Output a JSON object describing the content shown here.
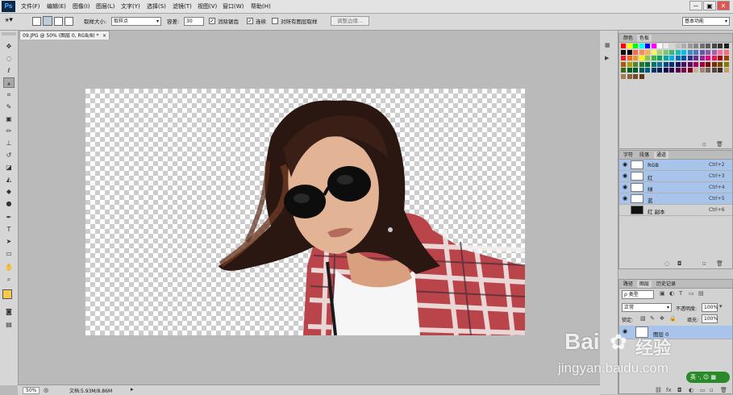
{
  "app": {
    "logo": "Ps"
  },
  "menu": [
    "文件(F)",
    "编辑(E)",
    "图像(I)",
    "图层(L)",
    "文字(Y)",
    "选择(S)",
    "滤镜(T)",
    "视图(V)",
    "窗口(W)",
    "帮助(H)"
  ],
  "window_controls": [
    "－",
    "▣",
    "✕"
  ],
  "options": {
    "sample_size_label": "取样大小:",
    "sample_size_value": "取样点",
    "tolerance_label": "容差:",
    "tolerance_value": "30",
    "antialias_label": "消除锯齿",
    "contiguous_label": "连续",
    "all_layers_label": "对所有图层取样",
    "refine_edge_label": "调整边缘...",
    "workspace": "基本功能"
  },
  "document": {
    "tab_title": "09.JPG @ 50% (图层 0, RGB/8) *",
    "close": "×"
  },
  "status": {
    "zoom": "50%",
    "doc_info": "文档:5.93M/8.86M"
  },
  "swatches_panel": {
    "tabs": [
      "颜色",
      "色板"
    ],
    "active": 1
  },
  "swatch_colors": [
    "#ff0000",
    "#ffff00",
    "#00ff00",
    "#00ffff",
    "#0000ff",
    "#ff00ff",
    "#ffffff",
    "#ebebeb",
    "#d6d6d6",
    "#c2c2c2",
    "#adadad",
    "#999999",
    "#858585",
    "#707070",
    "#5c5c5c",
    "#474747",
    "#333333",
    "#1f1f1f",
    "#0a0a0a",
    "#000000",
    "#f26c4f",
    "#f68e55",
    "#fbaf5c",
    "#fff467",
    "#acd372",
    "#7cc576",
    "#3bb878",
    "#1abbb4",
    "#00bff3",
    "#438ccb",
    "#5574b9",
    "#605ca8",
    "#855fa8",
    "#a763a8",
    "#f06ea9",
    "#f26d7d",
    "#ed1c24",
    "#f26522",
    "#f7941d",
    "#fff200",
    "#8dc73f",
    "#39b54a",
    "#00a651",
    "#00a99d",
    "#00aeef",
    "#0072bc",
    "#0054a6",
    "#2e3192",
    "#662d91",
    "#92278f",
    "#ec008c",
    "#ed145b",
    "#9e0b0f",
    "#a0410d",
    "#a3620a",
    "#aba000",
    "#598527",
    "#197b30",
    "#007236",
    "#00746b",
    "#0076a3",
    "#004a80",
    "#003471",
    "#1b1464",
    "#440e62",
    "#630460",
    "#9e005d",
    "#9e0039",
    "#790000",
    "#7b2e00",
    "#7d4900",
    "#827b00",
    "#406618",
    "#005e20",
    "#005826",
    "#005952",
    "#005b7f",
    "#003663",
    "#002157",
    "#0d004c",
    "#32004b",
    "#4b0049",
    "#7b0046",
    "#7a0026",
    "#c7b299",
    "#998675",
    "#736357",
    "#534741",
    "#37302a",
    "#c69c6d",
    "#a67c52",
    "#8c6239",
    "#754c24",
    "#603913"
  ],
  "channels_panel": {
    "tabs": [
      "字符",
      "段落",
      "通道"
    ],
    "active": 2,
    "rows": [
      {
        "name": "RGB",
        "shortcut": "Ctrl+2",
        "selected": true,
        "visible": true
      },
      {
        "name": "红",
        "shortcut": "Ctrl+3",
        "selected": true,
        "visible": true
      },
      {
        "name": "绿",
        "shortcut": "Ctrl+4",
        "selected": true,
        "visible": true
      },
      {
        "name": "蓝",
        "shortcut": "Ctrl+5",
        "selected": true,
        "visible": true
      },
      {
        "name": "红 副本",
        "shortcut": "Ctrl+6",
        "selected": false,
        "visible": false
      }
    ]
  },
  "layers_panel": {
    "tabs": [
      "路径",
      "图层",
      "历史记录"
    ],
    "active": 1,
    "filter_label": "ρ 类型",
    "blend_mode": "正常",
    "opacity_label": "不透明度:",
    "opacity_value": "100%",
    "lock_label": "锁定:",
    "fill_label": "填充:",
    "fill_value": "100%",
    "layer_name": "图层 0"
  },
  "watermark": {
    "brand": "Bai",
    "brand2": "经验",
    "url": "jingyan.baidu.com"
  },
  "ime": {
    "label": "英 ·,  ☺ ▦"
  }
}
